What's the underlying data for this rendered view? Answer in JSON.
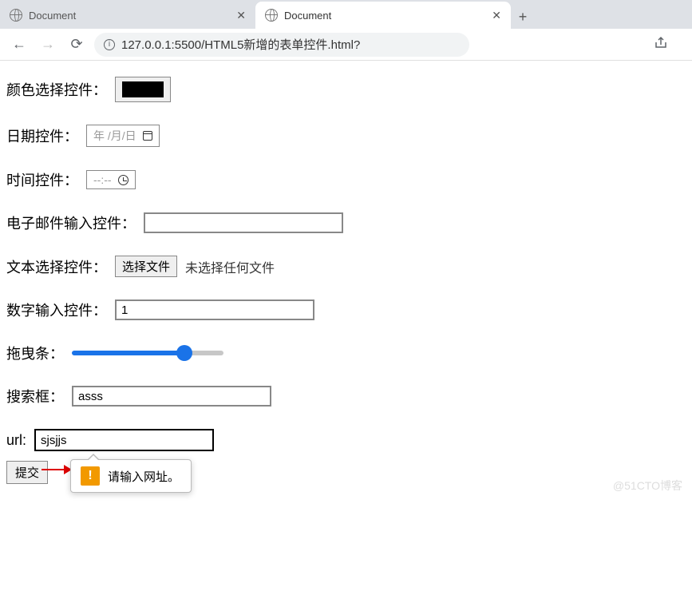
{
  "tabs": [
    {
      "title": "Document",
      "active": false
    },
    {
      "title": "Document",
      "active": true
    }
  ],
  "toolbar": {
    "url": "127.0.0.1:5500/HTML5新增的表单控件.html?"
  },
  "form": {
    "color": {
      "label": "颜色选择控件：",
      "value": "#000000"
    },
    "date": {
      "label": "日期控件：",
      "placeholder": "年 /月/日"
    },
    "time": {
      "label": "时间控件：",
      "placeholder": "--:--"
    },
    "email": {
      "label": "电子邮件输入控件：",
      "value": ""
    },
    "file": {
      "label": "文本选择控件：",
      "button": "选择文件",
      "status": "未选择任何文件"
    },
    "number": {
      "label": "数字输入控件：",
      "value": "1"
    },
    "range": {
      "label": "拖曳条："
    },
    "search": {
      "label": "搜索框：",
      "value": "asss"
    },
    "url": {
      "label": "url:",
      "value": "sjsjjs"
    },
    "submit": {
      "label": "提交"
    },
    "validation": {
      "message": "请输入网址。"
    }
  },
  "watermark": "@51CTO博客"
}
